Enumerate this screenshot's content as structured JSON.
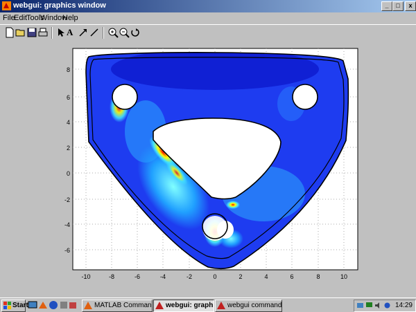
{
  "window": {
    "title": "webgui: graphics window",
    "controls": [
      "_",
      "□",
      "x"
    ]
  },
  "menu": [
    {
      "label": "File"
    },
    {
      "label": "Edit"
    },
    {
      "label": "Tools"
    },
    {
      "label": "Window"
    },
    {
      "label": "Help"
    }
  ],
  "toolbar": {
    "buttons": [
      "new-icon",
      "open-icon",
      "save-icon",
      "print-icon",
      "pointer-icon",
      "text-icon",
      "arrow-icon",
      "line-icon",
      "zoom-in-icon",
      "zoom-out-icon",
      "rotate-icon"
    ],
    "text_tool_label": "A"
  },
  "plot": {
    "x_ticks": [
      "-10",
      "-8",
      "-6",
      "-4",
      "-2",
      "0",
      "2",
      "4",
      "6",
      "8",
      "10"
    ],
    "y_ticks": [
      "8",
      "6",
      "4",
      "2",
      "0",
      "-2",
      "-4",
      "-6"
    ],
    "xlim": [
      -11,
      11
    ],
    "ylim": [
      -7.5,
      9.5
    ],
    "colormap": "jet"
  },
  "taskbar": {
    "start_label": "Start",
    "tasks": [
      {
        "label": "MATLAB Command Window",
        "active": false
      },
      {
        "label": "webgui: graphics win...",
        "active": true
      },
      {
        "label": "webgui command window ...",
        "active": false
      }
    ],
    "clock": "14:29"
  }
}
